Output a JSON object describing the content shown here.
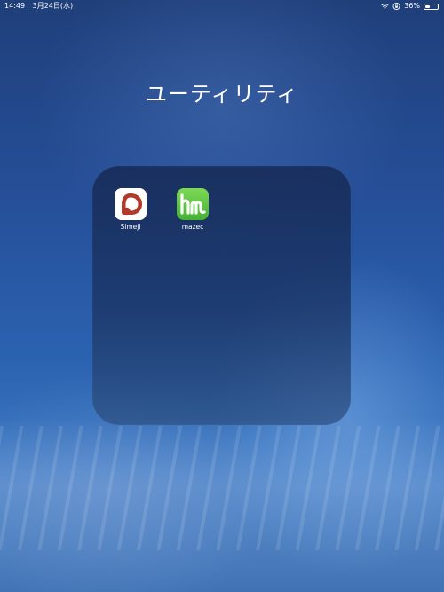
{
  "status_bar": {
    "time": "14:49",
    "date": "3月24日(水)",
    "battery_percent": "36%",
    "battery_level": 0.36
  },
  "folder": {
    "title": "ユーティリティ",
    "apps": [
      {
        "label": "Simeji",
        "icon": "simeji-icon",
        "color": "#b23a2b"
      },
      {
        "label": "mazec",
        "icon": "mazec-icon",
        "color": "#4cb63a"
      }
    ]
  }
}
